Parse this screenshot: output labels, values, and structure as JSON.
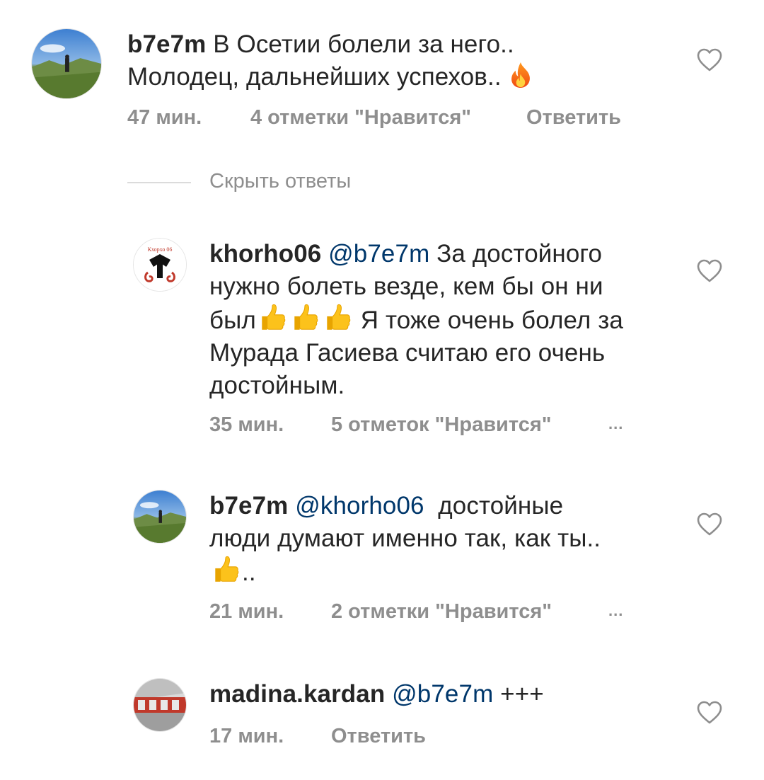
{
  "comments": [
    {
      "username": "b7e7m",
      "text": "В Осетии болели за него..",
      "text2": "Молодец, дальнейших успехов..",
      "emoji": "fire",
      "time": "47 мин.",
      "likes": "4 отметки \"Нравится\"",
      "reply": "Ответить"
    },
    {
      "username": "khorho06",
      "mention": "@b7e7m",
      "line1": "За достойного",
      "line2": "нужно болеть везде, кем бы он ни",
      "line3a": "был",
      "line3b": "Я тоже очень болел за",
      "line4": "Мурада Гасиева считаю его очень",
      "line5": "достойным.",
      "time": "35 мин.",
      "likes": "5 отметок \"Нравится\"",
      "more": "..."
    },
    {
      "username": "b7e7m",
      "mention": "@khorho06",
      "line1": "достойные",
      "line2": "люди думают именно так, как ты..",
      "line3": "..",
      "time": "21 мин.",
      "likes": "2 отметки \"Нравится\"",
      "more": "..."
    },
    {
      "username": "madina.kardan",
      "mention": "@b7e7m",
      "text": "+++",
      "time": "17 мин.",
      "reply": "Ответить"
    }
  ],
  "hide_replies": "Скрыть ответы",
  "avatar_logo_text": "Кхорхо 06",
  "icons": {
    "like": "heart-outline-icon",
    "fire": "fire-emoji-icon",
    "thumb": "thumbs-up-emoji-icon"
  },
  "colors": {
    "text": "#262626",
    "secondary": "#8e8e8e",
    "mention": "#00376b",
    "divider": "#dbdbdb"
  }
}
